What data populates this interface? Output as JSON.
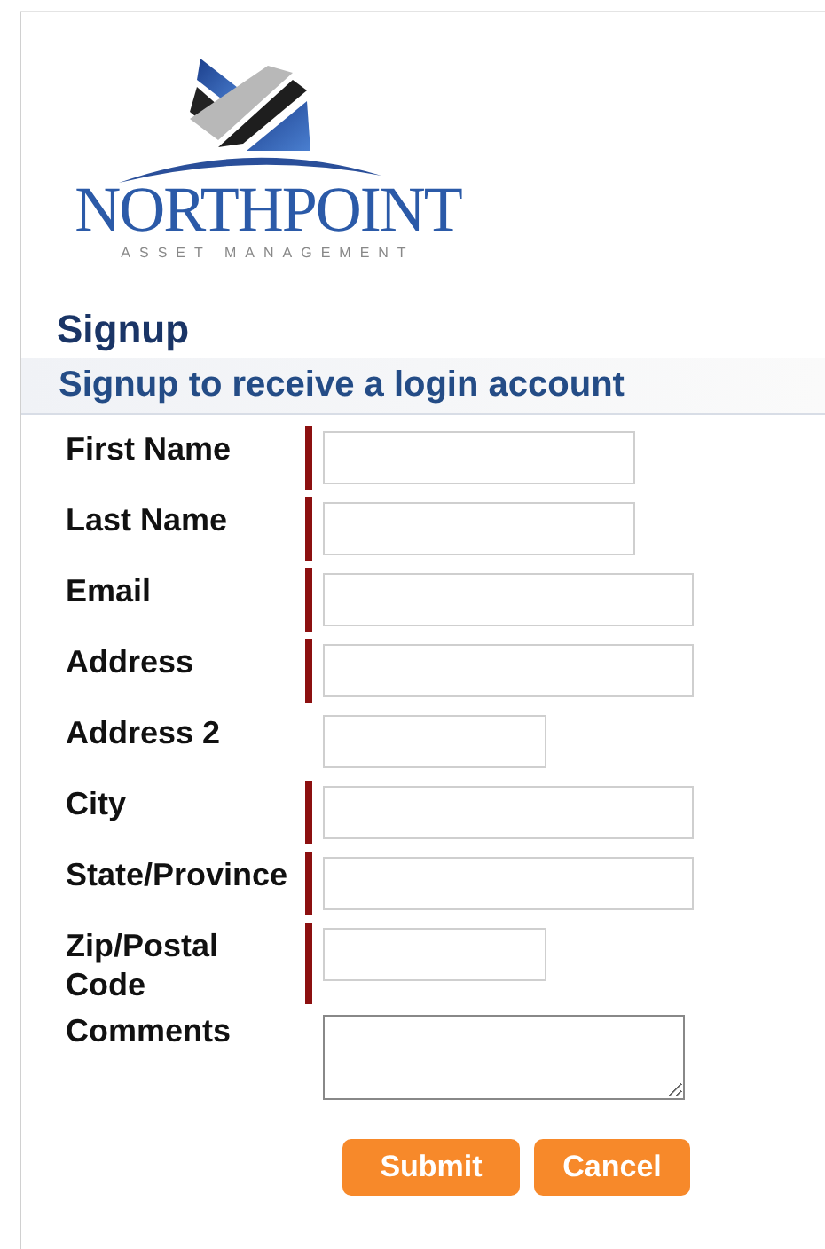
{
  "logo": {
    "name": "NORTHPOINT",
    "tagline": "ASSET MANAGEMENT"
  },
  "page_title": "Signup",
  "section_title": "Signup to receive a login account",
  "fields": [
    {
      "label": "First Name",
      "required": true,
      "kind": "medium"
    },
    {
      "label": "Last Name",
      "required": true,
      "kind": "medium"
    },
    {
      "label": "Email",
      "required": true,
      "kind": "long"
    },
    {
      "label": "Address",
      "required": true,
      "kind": "long"
    },
    {
      "label": "Address 2",
      "required": false,
      "kind": "short"
    },
    {
      "label": "City",
      "required": true,
      "kind": "long"
    },
    {
      "label": "State/Province",
      "required": true,
      "kind": "long"
    },
    {
      "label": "Zip/Postal Code",
      "required": true,
      "kind": "short"
    },
    {
      "label": "Comments",
      "required": false,
      "kind": "textarea"
    }
  ],
  "buttons": [
    "Submit",
    "Cancel"
  ]
}
